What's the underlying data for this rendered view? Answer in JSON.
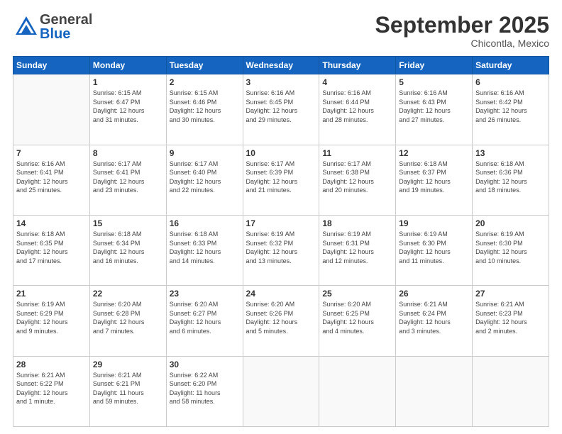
{
  "header": {
    "logo_general": "General",
    "logo_blue": "Blue",
    "month_title": "September 2025",
    "location": "Chicontla, Mexico"
  },
  "weekdays": [
    "Sunday",
    "Monday",
    "Tuesday",
    "Wednesday",
    "Thursday",
    "Friday",
    "Saturday"
  ],
  "weeks": [
    [
      {
        "day": "",
        "info": ""
      },
      {
        "day": "1",
        "info": "Sunrise: 6:15 AM\nSunset: 6:47 PM\nDaylight: 12 hours\nand 31 minutes."
      },
      {
        "day": "2",
        "info": "Sunrise: 6:15 AM\nSunset: 6:46 PM\nDaylight: 12 hours\nand 30 minutes."
      },
      {
        "day": "3",
        "info": "Sunrise: 6:16 AM\nSunset: 6:45 PM\nDaylight: 12 hours\nand 29 minutes."
      },
      {
        "day": "4",
        "info": "Sunrise: 6:16 AM\nSunset: 6:44 PM\nDaylight: 12 hours\nand 28 minutes."
      },
      {
        "day": "5",
        "info": "Sunrise: 6:16 AM\nSunset: 6:43 PM\nDaylight: 12 hours\nand 27 minutes."
      },
      {
        "day": "6",
        "info": "Sunrise: 6:16 AM\nSunset: 6:42 PM\nDaylight: 12 hours\nand 26 minutes."
      }
    ],
    [
      {
        "day": "7",
        "info": "Sunrise: 6:16 AM\nSunset: 6:41 PM\nDaylight: 12 hours\nand 25 minutes."
      },
      {
        "day": "8",
        "info": "Sunrise: 6:17 AM\nSunset: 6:41 PM\nDaylight: 12 hours\nand 23 minutes."
      },
      {
        "day": "9",
        "info": "Sunrise: 6:17 AM\nSunset: 6:40 PM\nDaylight: 12 hours\nand 22 minutes."
      },
      {
        "day": "10",
        "info": "Sunrise: 6:17 AM\nSunset: 6:39 PM\nDaylight: 12 hours\nand 21 minutes."
      },
      {
        "day": "11",
        "info": "Sunrise: 6:17 AM\nSunset: 6:38 PM\nDaylight: 12 hours\nand 20 minutes."
      },
      {
        "day": "12",
        "info": "Sunrise: 6:18 AM\nSunset: 6:37 PM\nDaylight: 12 hours\nand 19 minutes."
      },
      {
        "day": "13",
        "info": "Sunrise: 6:18 AM\nSunset: 6:36 PM\nDaylight: 12 hours\nand 18 minutes."
      }
    ],
    [
      {
        "day": "14",
        "info": "Sunrise: 6:18 AM\nSunset: 6:35 PM\nDaylight: 12 hours\nand 17 minutes."
      },
      {
        "day": "15",
        "info": "Sunrise: 6:18 AM\nSunset: 6:34 PM\nDaylight: 12 hours\nand 16 minutes."
      },
      {
        "day": "16",
        "info": "Sunrise: 6:18 AM\nSunset: 6:33 PM\nDaylight: 12 hours\nand 14 minutes."
      },
      {
        "day": "17",
        "info": "Sunrise: 6:19 AM\nSunset: 6:32 PM\nDaylight: 12 hours\nand 13 minutes."
      },
      {
        "day": "18",
        "info": "Sunrise: 6:19 AM\nSunset: 6:31 PM\nDaylight: 12 hours\nand 12 minutes."
      },
      {
        "day": "19",
        "info": "Sunrise: 6:19 AM\nSunset: 6:30 PM\nDaylight: 12 hours\nand 11 minutes."
      },
      {
        "day": "20",
        "info": "Sunrise: 6:19 AM\nSunset: 6:30 PM\nDaylight: 12 hours\nand 10 minutes."
      }
    ],
    [
      {
        "day": "21",
        "info": "Sunrise: 6:19 AM\nSunset: 6:29 PM\nDaylight: 12 hours\nand 9 minutes."
      },
      {
        "day": "22",
        "info": "Sunrise: 6:20 AM\nSunset: 6:28 PM\nDaylight: 12 hours\nand 7 minutes."
      },
      {
        "day": "23",
        "info": "Sunrise: 6:20 AM\nSunset: 6:27 PM\nDaylight: 12 hours\nand 6 minutes."
      },
      {
        "day": "24",
        "info": "Sunrise: 6:20 AM\nSunset: 6:26 PM\nDaylight: 12 hours\nand 5 minutes."
      },
      {
        "day": "25",
        "info": "Sunrise: 6:20 AM\nSunset: 6:25 PM\nDaylight: 12 hours\nand 4 minutes."
      },
      {
        "day": "26",
        "info": "Sunrise: 6:21 AM\nSunset: 6:24 PM\nDaylight: 12 hours\nand 3 minutes."
      },
      {
        "day": "27",
        "info": "Sunrise: 6:21 AM\nSunset: 6:23 PM\nDaylight: 12 hours\nand 2 minutes."
      }
    ],
    [
      {
        "day": "28",
        "info": "Sunrise: 6:21 AM\nSunset: 6:22 PM\nDaylight: 12 hours\nand 1 minute."
      },
      {
        "day": "29",
        "info": "Sunrise: 6:21 AM\nSunset: 6:21 PM\nDaylight: 11 hours\nand 59 minutes."
      },
      {
        "day": "30",
        "info": "Sunrise: 6:22 AM\nSunset: 6:20 PM\nDaylight: 11 hours\nand 58 minutes."
      },
      {
        "day": "",
        "info": ""
      },
      {
        "day": "",
        "info": ""
      },
      {
        "day": "",
        "info": ""
      },
      {
        "day": "",
        "info": ""
      }
    ]
  ]
}
